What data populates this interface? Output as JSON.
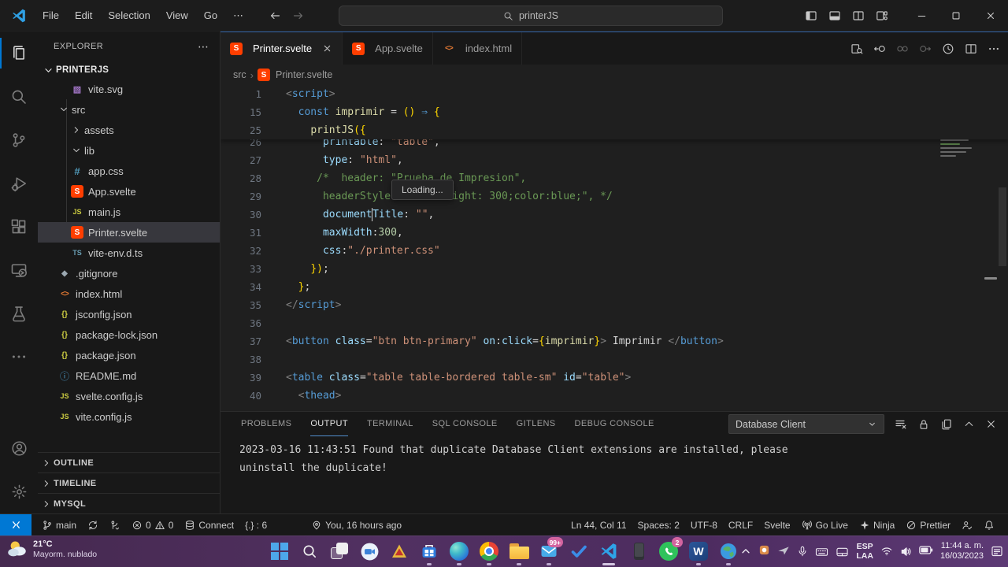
{
  "colors": {
    "accent": "#0078d4",
    "remote": "#0078d4",
    "svelte": "#ff3e00",
    "taskbar": "#513061",
    "editor_bg": "#1f1f1f",
    "chrome_bg": "#181818"
  },
  "title_bar": {
    "menus": [
      "File",
      "Edit",
      "Selection",
      "View",
      "Go",
      "⋯"
    ],
    "search_value": "printerJS"
  },
  "activity_bar": {
    "top": [
      {
        "name": "explorer",
        "icon": "files",
        "active": true
      },
      {
        "name": "search",
        "icon": "search",
        "active": false
      },
      {
        "name": "source-control",
        "icon": "scm",
        "active": false
      },
      {
        "name": "run-debug",
        "icon": "debug",
        "active": false
      },
      {
        "name": "extensions",
        "icon": "extensions",
        "active": false
      },
      {
        "name": "remote-explorer",
        "icon": "remote-monitor",
        "active": false
      },
      {
        "name": "testing",
        "icon": "beaker",
        "active": false
      },
      {
        "name": "more-views",
        "icon": "ellipsis",
        "active": false
      }
    ],
    "bottom": [
      {
        "name": "accounts",
        "icon": "account"
      },
      {
        "name": "settings",
        "icon": "gear"
      }
    ]
  },
  "explorer": {
    "header": "EXPLORER",
    "root": "PRINTERJS",
    "files": [
      {
        "label": "vite.svg",
        "icon": "image",
        "level": 2
      },
      {
        "label": "src",
        "chevron": "down",
        "level": 1
      },
      {
        "label": "assets",
        "chevron": "right",
        "level": 2
      },
      {
        "label": "lib",
        "chevron": "down",
        "level": 2
      },
      {
        "label": "app.css",
        "icon": "css",
        "level": 2
      },
      {
        "label": "App.svelte",
        "icon": "svelte",
        "level": 2
      },
      {
        "label": "main.js",
        "icon": "js",
        "level": 2
      },
      {
        "label": "Printer.svelte",
        "icon": "svelte",
        "level": 2,
        "selected": true
      },
      {
        "label": "vite-env.d.ts",
        "icon": "ts",
        "level": 2
      },
      {
        "label": ".gitignore",
        "icon": "git",
        "level": 1
      },
      {
        "label": "index.html",
        "icon": "html",
        "level": 1
      },
      {
        "label": "jsconfig.json",
        "icon": "json",
        "level": 1
      },
      {
        "label": "package-lock.json",
        "icon": "json",
        "level": 1
      },
      {
        "label": "package.json",
        "icon": "json",
        "level": 1
      },
      {
        "label": "README.md",
        "icon": "info",
        "level": 1
      },
      {
        "label": "svelte.config.js",
        "icon": "js",
        "level": 1
      },
      {
        "label": "vite.config.js",
        "icon": "js",
        "level": 1
      }
    ],
    "sections": [
      "OUTLINE",
      "TIMELINE",
      "MYSQL"
    ]
  },
  "tabs": [
    {
      "label": "Printer.svelte",
      "icon": "svelte",
      "active": true,
      "closable": true
    },
    {
      "label": "App.svelte",
      "icon": "svelte",
      "active": false
    },
    {
      "label": "index.html",
      "icon": "html",
      "active": false
    }
  ],
  "breadcrumb": {
    "folder": "src",
    "file": "Printer.svelte"
  },
  "editor": {
    "tooltip": "Loading...",
    "sticky_lines": [
      {
        "n": "1",
        "segs": [
          [
            "<",
            "pun"
          ],
          [
            "script",
            "tag"
          ],
          [
            ">",
            "pun"
          ]
        ]
      },
      {
        "n": "15",
        "segs": [
          [
            "  ",
            "fg"
          ],
          [
            "const ",
            "kw"
          ],
          [
            "imprimir",
            "fn"
          ],
          [
            " = ",
            "fg"
          ],
          [
            "()",
            "gold"
          ],
          [
            " ",
            "fg"
          ],
          [
            "⇒",
            "kw"
          ],
          [
            " ",
            "fg"
          ],
          [
            "{",
            "gold"
          ]
        ]
      },
      {
        "n": "25",
        "segs": [
          [
            "    ",
            "fg"
          ],
          [
            "printJS",
            "fn"
          ],
          [
            "({",
            "gold"
          ]
        ]
      }
    ],
    "lines": [
      {
        "n": "26",
        "segs": [
          [
            "      ",
            "fg"
          ],
          [
            "printable",
            "prop"
          ],
          [
            ": ",
            "fg"
          ],
          [
            "\"table\"",
            "str"
          ],
          [
            ",",
            "fg"
          ]
        ]
      },
      {
        "n": "27",
        "segs": [
          [
            "      ",
            "fg"
          ],
          [
            "type",
            "prop"
          ],
          [
            ": ",
            "fg"
          ],
          [
            "\"html\"",
            "str"
          ],
          [
            ",",
            "fg"
          ]
        ]
      },
      {
        "n": "28",
        "segs": [
          [
            "     ",
            "fg"
          ],
          [
            "/*  header: \"Prueba de Impresion\",",
            "com"
          ]
        ]
      },
      {
        "n": "29",
        "segs": [
          [
            "      ",
            "fg"
          ],
          [
            "headerStyle: \"font-weight: 300;color:blue;\", */",
            "com"
          ]
        ]
      },
      {
        "n": "30",
        "segs": [
          [
            "      ",
            "fg"
          ],
          [
            "document",
            "prop"
          ],
          [
            "",
            "caret"
          ],
          [
            "Title",
            "prop"
          ],
          [
            ": ",
            "fg"
          ],
          [
            "\"\"",
            "str"
          ],
          [
            ",",
            "fg"
          ]
        ]
      },
      {
        "n": "31",
        "segs": [
          [
            "      ",
            "fg"
          ],
          [
            "maxWidth",
            "prop"
          ],
          [
            ":",
            "fg"
          ],
          [
            "300",
            "num"
          ],
          [
            ",",
            "fg"
          ]
        ]
      },
      {
        "n": "32",
        "segs": [
          [
            "      ",
            "fg"
          ],
          [
            "css",
            "prop"
          ],
          [
            ":",
            "fg"
          ],
          [
            "\"./printer.css\"",
            "str"
          ]
        ]
      },
      {
        "n": "33",
        "segs": [
          [
            "    ",
            "fg"
          ],
          [
            "})",
            "gold"
          ],
          [
            ";",
            "fg"
          ]
        ]
      },
      {
        "n": "34",
        "segs": [
          [
            "  ",
            "fg"
          ],
          [
            "}",
            "gold"
          ],
          [
            ";",
            "fg"
          ]
        ]
      },
      {
        "n": "35",
        "segs": [
          [
            "</",
            "pun"
          ],
          [
            "script",
            "tag"
          ],
          [
            ">",
            "pun"
          ]
        ]
      },
      {
        "n": "36",
        "segs": []
      },
      {
        "n": "37",
        "segs": [
          [
            "<",
            "pun"
          ],
          [
            "button",
            "tag"
          ],
          [
            " ",
            "fg"
          ],
          [
            "class",
            "attr"
          ],
          [
            "=",
            "fg"
          ],
          [
            "\"btn btn-primary\"",
            "str"
          ],
          [
            " ",
            "fg"
          ],
          [
            "on",
            "attr"
          ],
          [
            ":",
            "fg"
          ],
          [
            "click",
            "attr"
          ],
          [
            "=",
            "fg"
          ],
          [
            "{",
            "gold"
          ],
          [
            "imprimir",
            "fn"
          ],
          [
            "}",
            "gold"
          ],
          [
            ">",
            "pun"
          ],
          [
            " Imprimir ",
            "fg"
          ],
          [
            "</",
            "pun"
          ],
          [
            "button",
            "tag"
          ],
          [
            ">",
            "pun"
          ]
        ]
      },
      {
        "n": "38",
        "segs": []
      },
      {
        "n": "39",
        "segs": [
          [
            "<",
            "pun"
          ],
          [
            "table",
            "tag"
          ],
          [
            " ",
            "fg"
          ],
          [
            "class",
            "attr"
          ],
          [
            "=",
            "fg"
          ],
          [
            "\"table table-bordered table-sm\"",
            "str"
          ],
          [
            " ",
            "fg"
          ],
          [
            "id",
            "attr"
          ],
          [
            "=",
            "fg"
          ],
          [
            "\"table\"",
            "str"
          ],
          [
            ">",
            "pun"
          ]
        ]
      },
      {
        "n": "40",
        "segs": [
          [
            "  ",
            "fg"
          ],
          [
            "<",
            "pun"
          ],
          [
            "thead",
            "tag"
          ],
          [
            ">",
            "pun"
          ]
        ]
      }
    ]
  },
  "panel": {
    "tabs": [
      "PROBLEMS",
      "OUTPUT",
      "TERMINAL",
      "SQL CONSOLE",
      "GITLENS",
      "DEBUG CONSOLE"
    ],
    "active_tab": "OUTPUT",
    "dropdown_label": "Database Client",
    "output_lines": [
      "2023-03-16 11:43:51 Found that duplicate Database Client extensions are installed, please",
      "uninstall the duplicate!"
    ]
  },
  "status_bar": {
    "left": [
      {
        "name": "branch",
        "icon": "branch",
        "label": "main"
      },
      {
        "name": "sync",
        "icon": "sync",
        "label": ""
      },
      {
        "name": "gitlens",
        "icon": "gitlens",
        "label": ""
      },
      {
        "name": "problems",
        "icon": "error",
        "label": "0",
        "icon2": "warning",
        "label2": "0"
      },
      {
        "name": "db-connect",
        "icon": "db",
        "label": "Connect"
      },
      {
        "name": "bracket-count",
        "icon": "",
        "label": "{.} : 6"
      },
      {
        "name": "blame",
        "icon": "pin",
        "label": "You, 16 hours ago",
        "gap": true
      }
    ],
    "right": [
      {
        "name": "cursor-position",
        "icon": "",
        "label": "Ln 44, Col 11"
      },
      {
        "name": "indentation",
        "icon": "",
        "label": "Spaces: 2"
      },
      {
        "name": "encoding",
        "icon": "",
        "label": "UTF-8"
      },
      {
        "name": "eol",
        "icon": "",
        "label": "CRLF"
      },
      {
        "name": "language-mode",
        "icon": "",
        "label": "Svelte"
      },
      {
        "name": "go-live",
        "icon": "broadcast",
        "label": "Go Live"
      },
      {
        "name": "ninja",
        "icon": "ninja",
        "label": "Ninja"
      },
      {
        "name": "prettier",
        "icon": "slash",
        "label": "Prettier"
      },
      {
        "name": "feedback",
        "icon": "person-check",
        "label": ""
      },
      {
        "name": "notifications",
        "icon": "bell",
        "label": ""
      }
    ]
  },
  "taskbar": {
    "weather": {
      "temp": "21°C",
      "desc": "Mayorm. nublado"
    },
    "apps": [
      {
        "name": "start"
      },
      {
        "name": "search-taskbar"
      },
      {
        "name": "task-view"
      },
      {
        "name": "chat"
      },
      {
        "name": "triangle-app"
      },
      {
        "name": "store",
        "open": true
      },
      {
        "name": "edge",
        "open": true
      },
      {
        "name": "chrome",
        "open": true
      },
      {
        "name": "file-explorer",
        "open": true
      },
      {
        "name": "mail",
        "badge": "99+",
        "open": true
      },
      {
        "name": "check-app"
      },
      {
        "name": "vscode",
        "active": true
      },
      {
        "name": "phone-link"
      },
      {
        "name": "whatsapp",
        "badge": "2"
      },
      {
        "name": "word",
        "open": true
      },
      {
        "name": "earth-app",
        "open": true
      }
    ],
    "tray": {
      "lang_top": "ESP",
      "lang_bottom": "LAA",
      "time": "11:44 a. m.",
      "date": "16/03/2023"
    }
  }
}
